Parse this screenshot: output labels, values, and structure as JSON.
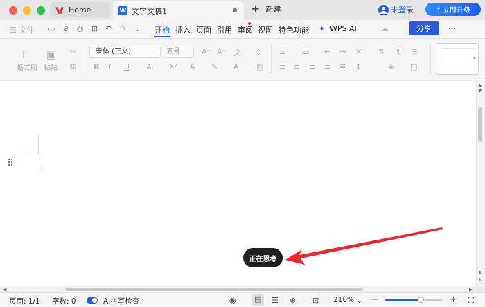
{
  "titlebar": {
    "home_tab": "Home",
    "doc_tab": "文字文稿1",
    "new_tab": "新建",
    "login": "未登录",
    "upgrade": "立即升级"
  },
  "menu": {
    "file": "文件",
    "tabs": [
      "开始",
      "插入",
      "页面",
      "引用",
      "审阅",
      "视图",
      "特色功能"
    ],
    "active_tab": "开始",
    "wps_ai": "WPS AI",
    "share": "分享",
    "more": "···"
  },
  "ribbon": {
    "format_painter": "格式刷",
    "paste": "粘贴",
    "font_name": "宋体 (正文)",
    "font_size": "五号"
  },
  "document": {
    "thinking_label": "正在思考"
  },
  "statusbar": {
    "page": "页面: 1/1",
    "word_count": "字数: 0",
    "ai_check": "AI拼写检查",
    "zoom": "210%",
    "zoom_level": 0.62
  },
  "colors": {
    "accent": "#2b5bd6",
    "arrow": "#e8282d",
    "thinking_bg": "#1f1f1f"
  }
}
